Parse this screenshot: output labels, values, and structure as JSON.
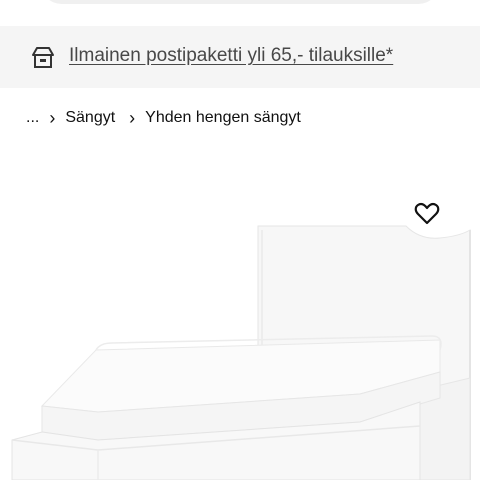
{
  "promo": {
    "text": "Ilmainen postipaketti yli 65,- tilauksille*",
    "icon": "package-icon"
  },
  "breadcrumb": {
    "items": [
      "...",
      "Sängyt",
      "Yhden hengen sängyt"
    ],
    "separator": "›"
  },
  "product": {
    "image": "white-single-bed-image",
    "favorite_icon": "heart-icon"
  },
  "colors": {
    "banner_bg": "#f5f5f5",
    "text": "#111111",
    "link_text": "#484848"
  }
}
